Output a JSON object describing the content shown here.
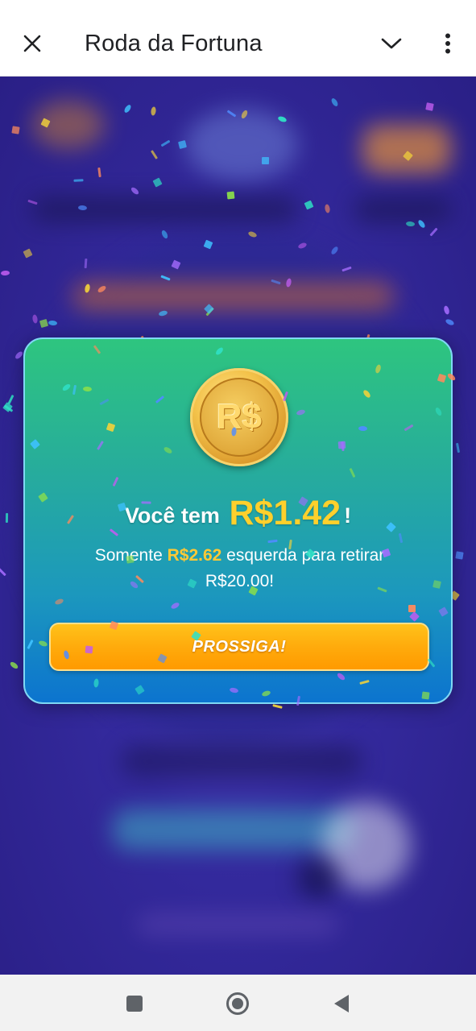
{
  "appbar": {
    "title": "Roda da Fortuna",
    "close_icon": "close-icon",
    "expand_icon": "chevron-down-icon",
    "more_icon": "more-vertical-icon"
  },
  "modal": {
    "coin_symbol": "R$",
    "headline_prefix": "Você tem",
    "headline_amount": "R$1.42",
    "headline_suffix": "!",
    "sub_prefix": "Somente",
    "sub_amount": "R$2.62",
    "sub_suffix": "esquerda para retirar",
    "sub_line2": "R$20.00!",
    "button_label": "PROSSIGA!"
  },
  "navbar": {
    "recents_icon": "square-recents-icon",
    "home_icon": "circle-home-icon",
    "back_icon": "triangle-back-icon"
  },
  "colors": {
    "accent_gold": "#ffd02c",
    "card_top": "#2ec57f",
    "card_bottom": "#0c74cf",
    "button": "#ffab0c",
    "background": "#2a2a8c"
  }
}
